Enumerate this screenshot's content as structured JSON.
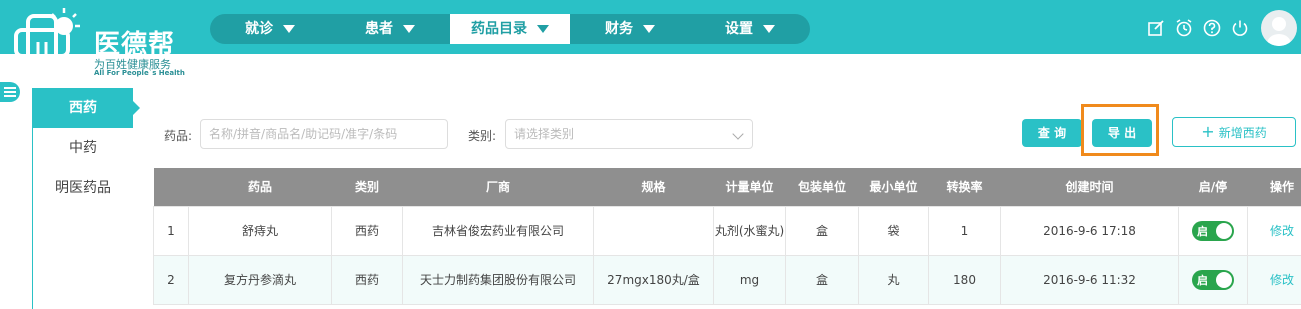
{
  "brand": {
    "name": "医德帮",
    "slogan": "为百姓健康服务",
    "slogan_en": "All For People`s Health",
    "primary_color": "#2ac1c6"
  },
  "nav": [
    {
      "label": "就诊",
      "active": false
    },
    {
      "label": "患者",
      "active": false
    },
    {
      "label": "药品目录",
      "active": true
    },
    {
      "label": "财务",
      "active": false
    },
    {
      "label": "设置",
      "active": false
    }
  ],
  "tools": [
    "edit-icon",
    "alarm-icon",
    "help-icon",
    "power-icon"
  ],
  "sidebar": [
    {
      "label": "西药",
      "active": true
    },
    {
      "label": "中药",
      "active": false
    },
    {
      "label": "明医药品",
      "active": false
    }
  ],
  "filters": {
    "drug_label": "药品:",
    "drug_placeholder": "名称/拼音/商品名/助记码/准字/条码",
    "category_label": "类别:",
    "category_placeholder": "请选择类别"
  },
  "buttons": {
    "query": "查 询",
    "export": "导 出",
    "add": "新增西药"
  },
  "table": {
    "headers": [
      "",
      "药品",
      "类别",
      "厂商",
      "规格",
      "计量单位",
      "包装单位",
      "最小单位",
      "转换率",
      "创建时间",
      "启/停",
      "操作"
    ],
    "rows": [
      {
        "index": "1",
        "drug": "舒痔丸",
        "category": "西药",
        "maker": "吉林省俊宏药业有限公司",
        "spec": "",
        "measure_unit": "丸剂(水蜜丸)",
        "pack_unit": "盒",
        "min_unit": "袋",
        "ratio": "1",
        "created": "2016-9-6 17:18",
        "status": "启",
        "action": "修改"
      },
      {
        "index": "2",
        "drug": "复方丹参滴丸",
        "category": "西药",
        "maker": "天士力制药集团股份有限公司",
        "spec": "27mgx180丸/盒",
        "measure_unit": "mg",
        "pack_unit": "盒",
        "min_unit": "丸",
        "ratio": "180",
        "created": "2016-9-6 11:32",
        "status": "启",
        "action": "修改"
      }
    ]
  }
}
